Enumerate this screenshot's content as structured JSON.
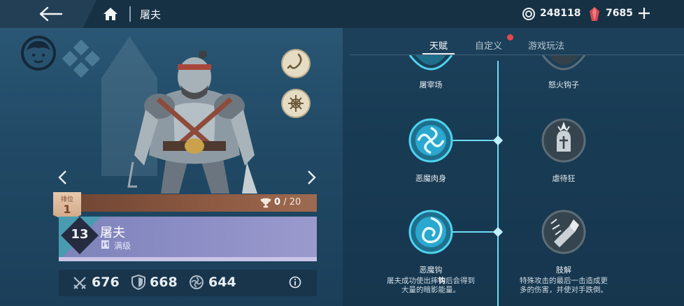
{
  "topbar": {
    "title": "屠夫",
    "coins": "248118",
    "gems": "7685",
    "back_icon": "back-arrow-icon",
    "home_icon": "home-icon",
    "coin_icon": "coin-icon",
    "gem_icon": "gem-icon",
    "add_icon": "plus-icon"
  },
  "hero": {
    "rank_label": "排位",
    "rank_value": "1",
    "trophy_value": "0",
    "trophy_max": "/ 20",
    "level": "13",
    "name": "屠夫",
    "max_level_label": "满级",
    "stats": {
      "attack": "676",
      "defense": "668",
      "energy": "644"
    }
  },
  "tabs": [
    {
      "label": "天赋",
      "active": true
    },
    {
      "label": "自定义",
      "notification": true
    },
    {
      "label": "游戏玩法",
      "active": false
    }
  ],
  "talents": {
    "top_left": {
      "label": "屠宰场"
    },
    "top_right": {
      "label": "怒火钩子"
    },
    "mid_left": {
      "label": "恶魔肉身"
    },
    "mid_right": {
      "label": "虐待狂"
    },
    "bottom_left": {
      "label": "恶魔钩",
      "desc_line1_a": "屠夫成功使出摔",
      "desc_line1_hl": "钩",
      "desc_line1_b": "后会得到",
      "desc_line2": "大量的暗影能量。"
    },
    "bottom_right": {
      "label": "肢解",
      "desc_line1": "特殊攻击的最后一击造成更",
      "desc_line2": "多的伤害，并使对手跌倒。"
    }
  },
  "colors": {
    "accent_cyan": "#4fd3f0",
    "notification_red": "#e24a4a",
    "rank_bar": "#8e5a42",
    "hero_card": "#8b8dc4"
  }
}
